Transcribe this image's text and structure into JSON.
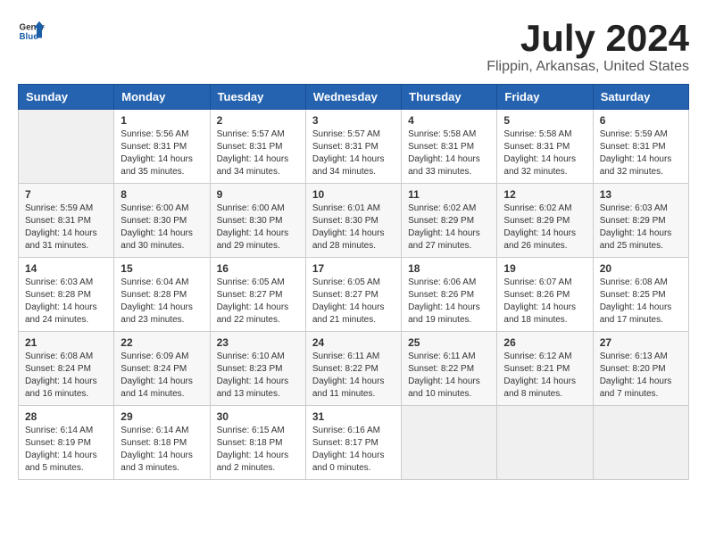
{
  "header": {
    "logo_general": "General",
    "logo_blue": "Blue",
    "month_year": "July 2024",
    "location": "Flippin, Arkansas, United States"
  },
  "days_of_week": [
    "Sunday",
    "Monday",
    "Tuesday",
    "Wednesday",
    "Thursday",
    "Friday",
    "Saturday"
  ],
  "weeks": [
    [
      {
        "day": "",
        "data": ""
      },
      {
        "day": "1",
        "data": "Sunrise: 5:56 AM\nSunset: 8:31 PM\nDaylight: 14 hours\nand 35 minutes."
      },
      {
        "day": "2",
        "data": "Sunrise: 5:57 AM\nSunset: 8:31 PM\nDaylight: 14 hours\nand 34 minutes."
      },
      {
        "day": "3",
        "data": "Sunrise: 5:57 AM\nSunset: 8:31 PM\nDaylight: 14 hours\nand 34 minutes."
      },
      {
        "day": "4",
        "data": "Sunrise: 5:58 AM\nSunset: 8:31 PM\nDaylight: 14 hours\nand 33 minutes."
      },
      {
        "day": "5",
        "data": "Sunrise: 5:58 AM\nSunset: 8:31 PM\nDaylight: 14 hours\nand 32 minutes."
      },
      {
        "day": "6",
        "data": "Sunrise: 5:59 AM\nSunset: 8:31 PM\nDaylight: 14 hours\nand 32 minutes."
      }
    ],
    [
      {
        "day": "7",
        "data": "Sunrise: 5:59 AM\nSunset: 8:31 PM\nDaylight: 14 hours\nand 31 minutes."
      },
      {
        "day": "8",
        "data": "Sunrise: 6:00 AM\nSunset: 8:30 PM\nDaylight: 14 hours\nand 30 minutes."
      },
      {
        "day": "9",
        "data": "Sunrise: 6:00 AM\nSunset: 8:30 PM\nDaylight: 14 hours\nand 29 minutes."
      },
      {
        "day": "10",
        "data": "Sunrise: 6:01 AM\nSunset: 8:30 PM\nDaylight: 14 hours\nand 28 minutes."
      },
      {
        "day": "11",
        "data": "Sunrise: 6:02 AM\nSunset: 8:29 PM\nDaylight: 14 hours\nand 27 minutes."
      },
      {
        "day": "12",
        "data": "Sunrise: 6:02 AM\nSunset: 8:29 PM\nDaylight: 14 hours\nand 26 minutes."
      },
      {
        "day": "13",
        "data": "Sunrise: 6:03 AM\nSunset: 8:29 PM\nDaylight: 14 hours\nand 25 minutes."
      }
    ],
    [
      {
        "day": "14",
        "data": "Sunrise: 6:03 AM\nSunset: 8:28 PM\nDaylight: 14 hours\nand 24 minutes."
      },
      {
        "day": "15",
        "data": "Sunrise: 6:04 AM\nSunset: 8:28 PM\nDaylight: 14 hours\nand 23 minutes."
      },
      {
        "day": "16",
        "data": "Sunrise: 6:05 AM\nSunset: 8:27 PM\nDaylight: 14 hours\nand 22 minutes."
      },
      {
        "day": "17",
        "data": "Sunrise: 6:05 AM\nSunset: 8:27 PM\nDaylight: 14 hours\nand 21 minutes."
      },
      {
        "day": "18",
        "data": "Sunrise: 6:06 AM\nSunset: 8:26 PM\nDaylight: 14 hours\nand 19 minutes."
      },
      {
        "day": "19",
        "data": "Sunrise: 6:07 AM\nSunset: 8:26 PM\nDaylight: 14 hours\nand 18 minutes."
      },
      {
        "day": "20",
        "data": "Sunrise: 6:08 AM\nSunset: 8:25 PM\nDaylight: 14 hours\nand 17 minutes."
      }
    ],
    [
      {
        "day": "21",
        "data": "Sunrise: 6:08 AM\nSunset: 8:24 PM\nDaylight: 14 hours\nand 16 minutes."
      },
      {
        "day": "22",
        "data": "Sunrise: 6:09 AM\nSunset: 8:24 PM\nDaylight: 14 hours\nand 14 minutes."
      },
      {
        "day": "23",
        "data": "Sunrise: 6:10 AM\nSunset: 8:23 PM\nDaylight: 14 hours\nand 13 minutes."
      },
      {
        "day": "24",
        "data": "Sunrise: 6:11 AM\nSunset: 8:22 PM\nDaylight: 14 hours\nand 11 minutes."
      },
      {
        "day": "25",
        "data": "Sunrise: 6:11 AM\nSunset: 8:22 PM\nDaylight: 14 hours\nand 10 minutes."
      },
      {
        "day": "26",
        "data": "Sunrise: 6:12 AM\nSunset: 8:21 PM\nDaylight: 14 hours\nand 8 minutes."
      },
      {
        "day": "27",
        "data": "Sunrise: 6:13 AM\nSunset: 8:20 PM\nDaylight: 14 hours\nand 7 minutes."
      }
    ],
    [
      {
        "day": "28",
        "data": "Sunrise: 6:14 AM\nSunset: 8:19 PM\nDaylight: 14 hours\nand 5 minutes."
      },
      {
        "day": "29",
        "data": "Sunrise: 6:14 AM\nSunset: 8:18 PM\nDaylight: 14 hours\nand 3 minutes."
      },
      {
        "day": "30",
        "data": "Sunrise: 6:15 AM\nSunset: 8:18 PM\nDaylight: 14 hours\nand 2 minutes."
      },
      {
        "day": "31",
        "data": "Sunrise: 6:16 AM\nSunset: 8:17 PM\nDaylight: 14 hours\nand 0 minutes."
      },
      {
        "day": "",
        "data": ""
      },
      {
        "day": "",
        "data": ""
      },
      {
        "day": "",
        "data": ""
      }
    ]
  ]
}
